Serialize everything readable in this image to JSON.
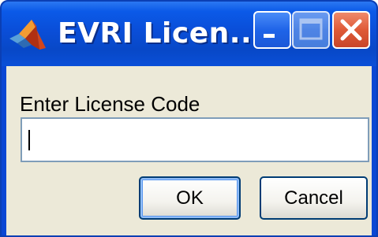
{
  "window": {
    "title": "EVRI Licen...",
    "app_icon": "matlab-membrane-icon",
    "controls": {
      "minimize_icon": "minimize-icon",
      "maximize_icon": "maximize-icon",
      "close_icon": "close-x-icon"
    }
  },
  "form": {
    "prompt_label": "Enter License Code",
    "license_code_value": "",
    "ok_label": "OK",
    "cancel_label": "Cancel"
  },
  "colors": {
    "titlebar_blue": "#0a4ed8",
    "close_red": "#df5a37",
    "client_bg": "#ece9d8",
    "input_border": "#7f9db9",
    "button_border": "#003c74"
  }
}
